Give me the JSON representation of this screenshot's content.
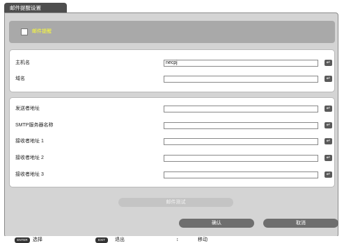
{
  "window": {
    "title": "邮件提醒设置"
  },
  "mail_alert": {
    "checked": false,
    "label": "邮件提醒"
  },
  "host": {
    "hostname_label": "主机名",
    "hostname_value": "necpj",
    "domain_label": "域名",
    "domain_value": ""
  },
  "mail": {
    "sender_label": "发送者地址",
    "sender_value": "",
    "smtp_label": "SMTP服务器名称",
    "smtp_value": "",
    "recipient1_label": "接收者地址 1",
    "recipient1_value": "",
    "recipient2_label": "接收者地址 2",
    "recipient2_value": "",
    "recipient3_label": "接收者地址 3",
    "recipient3_value": ""
  },
  "enter_glyph": "↵",
  "buttons": {
    "test": "邮件测试",
    "ok": "确认",
    "cancel": "取消"
  },
  "footer": {
    "enter_key": "ENTER",
    "enter_text": "选择",
    "exit_key": "EXIT",
    "exit_text": "退出",
    "move_icon": "updown-arrow-icon",
    "move_glyph": "↕",
    "move_text": "移动"
  },
  "colors": {
    "title_tab": "#4e4e4e",
    "panel": "#d4d4d4",
    "mail_bar": "#a9a9a9",
    "mail_label": "#ffff33",
    "button": "#6e6e6e",
    "test_button_disabled": "#c4c4c4"
  }
}
